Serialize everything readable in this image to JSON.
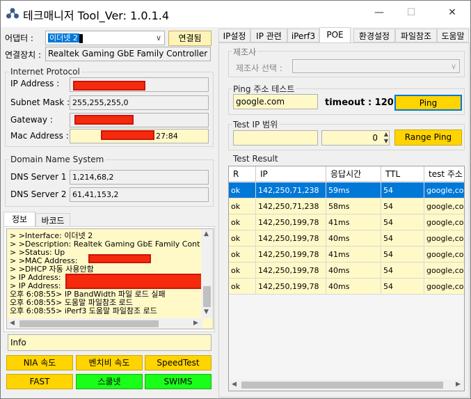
{
  "window": {
    "title": "테크매니저 Tool_Ver: 1.0.1.4",
    "minimize": "—",
    "maximize": "☐",
    "close": "✕"
  },
  "left": {
    "adapter_label": "어댑터 :",
    "adapter_value": "이더넷 2",
    "connected_button": "연결됨",
    "device_label": "연결장치 :",
    "device_value": "Realtek Gaming GbE Family Controller",
    "ip_group": "Internet Protocol",
    "ip_label": "IP Address :",
    "subnet_label": "Subnet Mask :",
    "subnet_value": "255,255,255,0",
    "gateway_label": "Gateway :",
    "mac_label": "Mac Address :",
    "mac_value": "27:84",
    "dns_group": "Domain Name System",
    "dns1_label": "DNS Server 1 :",
    "dns1_value": "1,214,68,2",
    "dns2_label": "DNS Server 2 :",
    "dns2_value": "61,41,153,2",
    "tabs": [
      "정보",
      "바코드"
    ],
    "log": [
      "> >Interface: 이더넷 2",
      "> >Description: Realtek Gaming GbE Family Cont",
      "> >Status: Up",
      "> >MAC Address:",
      "> >DHCP 자동 사용안함",
      "> IP Address:",
      "> IP Address:",
      "오후 6:08:55> IP BandWidth 파일 로드 실패",
      "오후 6:08:55> 도움말 파일참조 로드",
      "오후 6:08:55> iPerf3 도움말 파일참조 로드"
    ],
    "info_value": "Info",
    "buttons_row1": [
      "NIA 속도",
      "벤치비 속도",
      "SpeedTest"
    ],
    "buttons_row2": [
      "FAST",
      "스쿨넷",
      "SWIMS"
    ]
  },
  "right": {
    "tabs": [
      "IP설정",
      "IP 관련",
      "iPerf3",
      "POE",
      "환경설정",
      "파일참조",
      "도움말"
    ],
    "vendor_group": "제조사",
    "vendor_label": "제조사 선택 :",
    "ping_group": "Ping 주소 테스트",
    "ping_input": "google.com",
    "timeout_label": "timeout : 120",
    "ping_button": "Ping",
    "range_group": "Test IP 범위",
    "range_value": "0",
    "range_button": "Range Ping",
    "result_group": "Test Result",
    "columns": [
      "R",
      "IP",
      "응답시간",
      "TTL",
      "test 주소"
    ],
    "rows": [
      {
        "r": "ok",
        "ip": "142,250,71,238",
        "time": "59ms",
        "ttl": "54",
        "addr": "google,com"
      },
      {
        "r": "ok",
        "ip": "142,250,71,238",
        "time": "58ms",
        "ttl": "54",
        "addr": "google,com"
      },
      {
        "r": "ok",
        "ip": "142,250,199,78",
        "time": "41ms",
        "ttl": "54",
        "addr": "google,com"
      },
      {
        "r": "ok",
        "ip": "142,250,199,78",
        "time": "40ms",
        "ttl": "54",
        "addr": "google,com"
      },
      {
        "r": "ok",
        "ip": "142,250,199,78",
        "time": "41ms",
        "ttl": "54",
        "addr": "google,com"
      },
      {
        "r": "ok",
        "ip": "142,250,199,78",
        "time": "40ms",
        "ttl": "54",
        "addr": "google,com"
      },
      {
        "r": "ok",
        "ip": "142,250,199,78",
        "time": "40ms",
        "ttl": "54",
        "addr": "google,com"
      }
    ]
  }
}
